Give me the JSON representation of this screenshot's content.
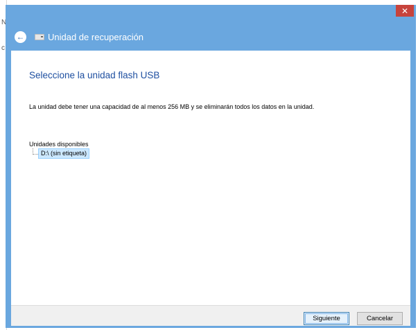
{
  "background_fragments": [
    "N",
    "c"
  ],
  "window": {
    "title": "Unidad de recuperación",
    "close_glyph": "✕",
    "back_glyph": "←"
  },
  "content": {
    "heading": "Seleccione la unidad flash USB",
    "description": "La unidad debe tener una capacidad de al menos 256 MB y se eliminarán todos los datos en la unidad.",
    "available_label": "Unidades disponibles",
    "drives": [
      "D:\\ (sin etiqueta)"
    ]
  },
  "buttons": {
    "next": "Siguiente",
    "cancel": "Cancelar"
  },
  "colors": {
    "title_bar": "#6aa7df",
    "close_button": "#c7433c",
    "heading": "#1e4fa0",
    "selection": "#cce8ff"
  },
  "icons": {
    "back": "back-arrow-icon",
    "drive": "usb-drive-icon",
    "close": "close-icon"
  }
}
